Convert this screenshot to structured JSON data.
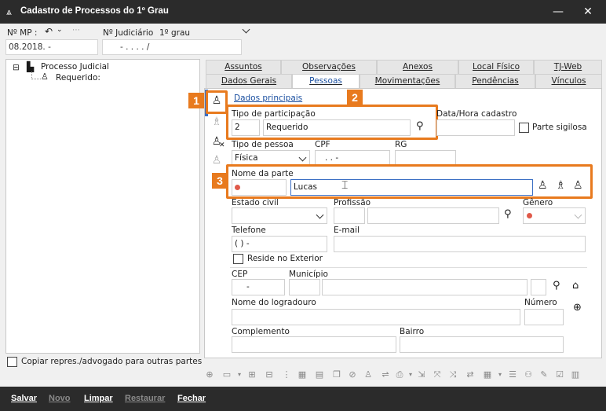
{
  "window": {
    "title": "Cadastro de Processos do 1º Grau",
    "minimize": "—",
    "close": "✕"
  },
  "header": {
    "mp_label": "Nº MP :",
    "mp_value": "08.2018.        -",
    "judiciario_label": "Nº Judiciário",
    "grau_label": "1º grau",
    "judiciario_value": "-     .    .  .  .      /"
  },
  "tree": {
    "root": "Processo Judicial",
    "child": "Requerido:",
    "expander": "⊟"
  },
  "copy_checkbox_label": "Copiar repres./advogado para outras partes",
  "tabs_row1": [
    "Assuntos",
    "Observações",
    "Anexos",
    "Local Físico",
    "TJ-Web"
  ],
  "tabs_row2": [
    "Dados Gerais",
    "Pessoas",
    "Movimentações",
    "Pendências",
    "Vínculos"
  ],
  "subtab": "Dados principais",
  "form": {
    "tipo_participacao_label": "Tipo de participação",
    "tipo_participacao_code": "2",
    "tipo_participacao_value": "Requerido",
    "data_hora_label": "Data/Hora cadastro",
    "parte_sigilosa_label": "Parte sigilosa",
    "tipo_pessoa_label": "Tipo de pessoa",
    "tipo_pessoa_value": "Física",
    "cpf_label": "CPF",
    "cpf_value": ".   .   -",
    "rg_label": "RG",
    "nome_parte_label": "Nome da parte",
    "nome_parte_value": "Lucas",
    "estado_civil_label": "Estado civil",
    "profissao_label": "Profissão",
    "genero_label": "Gênero",
    "telefone_label": "Telefone",
    "telefone_value": "(  )     -",
    "email_label": "E-mail",
    "reside_exterior_label": "Reside no Exterior",
    "cep_label": "CEP",
    "cep_value": "-",
    "municipio_label": "Município",
    "logradouro_label": "Nome do logradouro",
    "numero_label": "Número",
    "complemento_label": "Complemento",
    "bairro_label": "Bairro"
  },
  "badges": [
    "1",
    "2",
    "3"
  ],
  "bottom": {
    "salvar": "Salvar",
    "novo": "Novo",
    "limpar": "Limpar",
    "restaurar": "Restaurar",
    "fechar": "Fechar"
  },
  "colors": {
    "accent": "#e87a1e",
    "titlebar": "#2b2b2b",
    "link": "#1a4fa0"
  }
}
